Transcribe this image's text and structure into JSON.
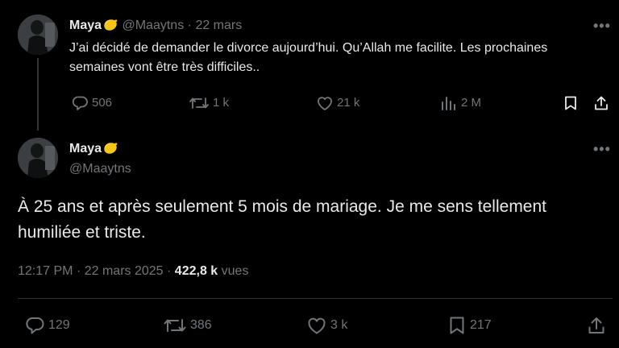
{
  "reply_tweet": {
    "display_name": "Maya",
    "emoji": "lemon-icon",
    "handle": "@Maaytns",
    "separator": "·",
    "date": "22 mars",
    "text": "J’ai décidé de demander le divorce aujourd’hui. Qu’Allah me facilite. Les prochaines semaines vont être très difficiles..",
    "actions": {
      "replies": "506",
      "retweets": "1 k",
      "likes": "21 k",
      "views": "2 M"
    }
  },
  "main_tweet": {
    "display_name": "Maya",
    "emoji": "lemon-icon",
    "handle": "@Maaytns",
    "text": "À 25 ans et après seulement 5 mois de mariage. Je me sens tellement humiliée et triste.",
    "time": "12:17 PM",
    "date": "22 mars 2025",
    "separator": "·",
    "views_count": "422,8 k",
    "views_label": "vues",
    "actions": {
      "replies": "129",
      "retweets": "386",
      "likes": "3 k",
      "bookmarks": "217"
    }
  },
  "colors": {
    "background": "#000000",
    "text_primary": "#e7e9ea",
    "text_secondary": "#71767b",
    "divider": "#2f3336"
  }
}
